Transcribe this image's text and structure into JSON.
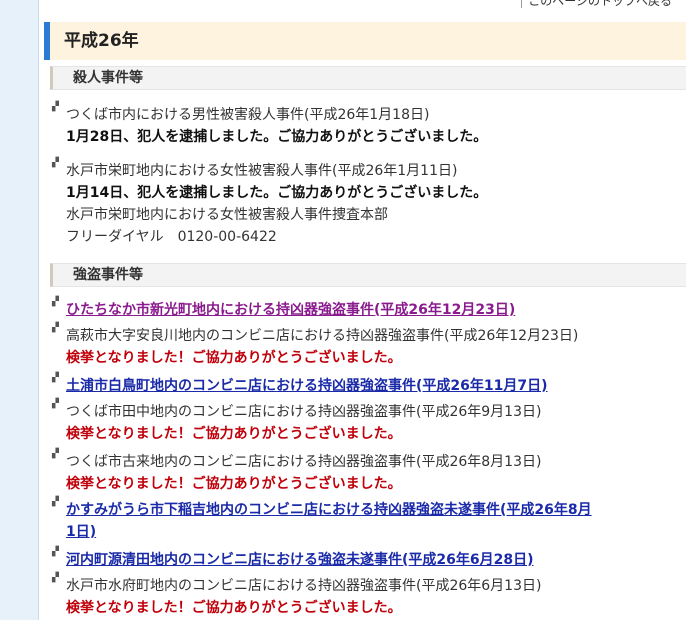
{
  "top_link": "このページのトップへ戻る",
  "year_heading": "平成26年",
  "sections": {
    "murder": {
      "heading": "殺人事件等",
      "items": [
        {
          "title": "つくば市内における男性被害殺人事件(平成26年1月18日)",
          "note": "1月28日、犯人を逮捕しました。ご協力ありがとうございました。"
        },
        {
          "title": "水戸市栄町地内における女性被害殺人事件(平成26年1月11日)",
          "note": "1月14日、犯人を逮捕しました。ご協力ありがとうございました。",
          "extra1": "水戸市栄町地内における女性被害殺人事件捜査本部",
          "extra2": "フリーダイヤル　0120-00-6422"
        }
      ]
    },
    "robbery": {
      "heading": "強盗事件等",
      "items": [
        {
          "title": "ひたちなか市新光町地内における持凶器強盗事件(平成26年12月23日)"
        },
        {
          "title": "高萩市大字安良川地内のコンビニ店における持凶器強盗事件(平成26年12月23日)",
          "note": "検挙となりました！ご協力ありがとうございました。"
        },
        {
          "title": "土浦市白鳥町地内のコンビニ店における持凶器強盗事件(平成26年11月7日)"
        },
        {
          "title": "つくば市田中地内のコンビニ店における持凶器強盗事件(平成26年9月13日)",
          "note": "検挙となりました！ご協力ありがとうございました。"
        },
        {
          "title": "つくば市古来地内のコンビニ店における持凶器強盗事件(平成26年8月13日)",
          "note": "検挙となりました！ご協力ありがとうございました。"
        },
        {
          "title_line1": "かすみがうら市下稲吉地内のコンビニ店における持凶器強盗未遂事件(平成26年8月",
          "title_line2": "1日)"
        },
        {
          "title": "河内町源清田地内のコンビニ店における強盗未遂事件(平成26年6月28日)"
        },
        {
          "title": "水戸市水府町地内のコンビニ店における持凶器強盗事件(平成26年6月13日)",
          "note": "検挙となりました！ご協力ありがとうございました。"
        }
      ]
    }
  }
}
